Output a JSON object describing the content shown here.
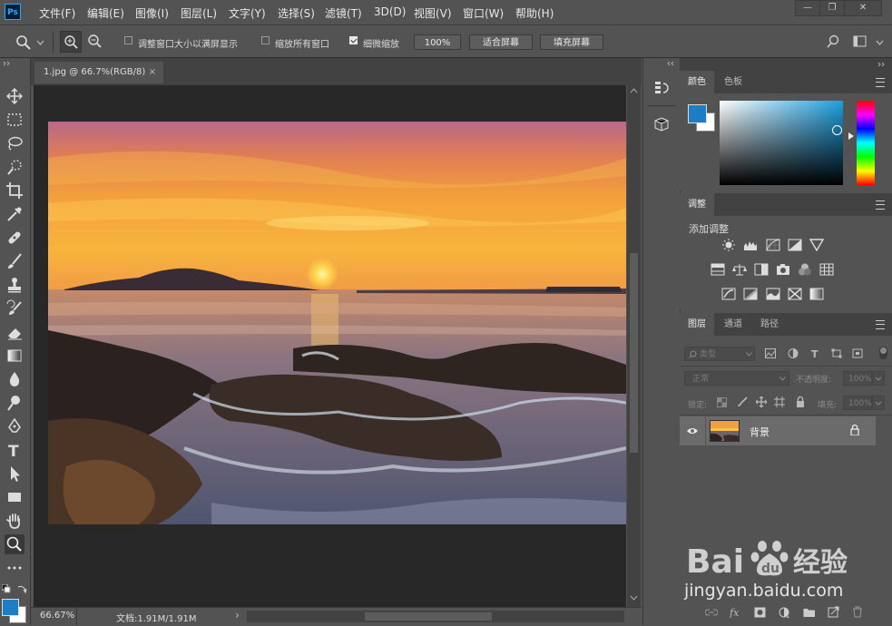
{
  "app": {
    "logo": "Ps"
  },
  "menu": [
    "文件(F)",
    "编辑(E)",
    "图像(I)",
    "图层(L)",
    "文字(Y)",
    "选择(S)",
    "滤镜(T)",
    "3D(D)",
    "视图(V)",
    "窗口(W)",
    "帮助(H)"
  ],
  "window_controls": {
    "minimize": "—",
    "restore": "❐",
    "close": "✕"
  },
  "options": {
    "resize_windows_label": "调整窗口大小以满屏显示",
    "resize_windows_checked": false,
    "zoom_all_label": "缩放所有窗口",
    "zoom_all_checked": false,
    "scrubby_zoom_label": "细微缩放",
    "scrubby_zoom_checked": true,
    "zoom_value": "100%",
    "fit_screen_label": "适合屏幕",
    "fill_screen_label": "填充屏幕"
  },
  "document": {
    "tab_title": "1.jpg @ 66.7%(RGB/8)",
    "tab_close": "×",
    "zoom_status": "66.67%",
    "doc_info": "文档:1.91M/1.91M",
    "status_arrow": "›"
  },
  "colors": {
    "foreground": "#1c7fc6",
    "background": "#ffffff",
    "accent": "#1c7fc6"
  },
  "color_panel": {
    "tabs": [
      "颜色",
      "色板"
    ],
    "active_tab": "颜色"
  },
  "adjustments_panel": {
    "tabs": [
      "调整"
    ],
    "add_adjustment_label": "添加调整"
  },
  "layers_panel": {
    "tabs": [
      "图层",
      "通道",
      "路径"
    ],
    "active_tab": "图层",
    "filter_kind": "类型",
    "blend_mode": "正常",
    "opacity_label": "不透明度:",
    "opacity_value": "100%",
    "lock_label": "锁定:",
    "fill_label": "填充:",
    "fill_value": "100%",
    "layers": [
      {
        "name": "背景",
        "visible": true,
        "locked": true
      }
    ]
  },
  "watermark": {
    "brand": "Bai du 经验",
    "url": "jingyan.baidu.com"
  }
}
